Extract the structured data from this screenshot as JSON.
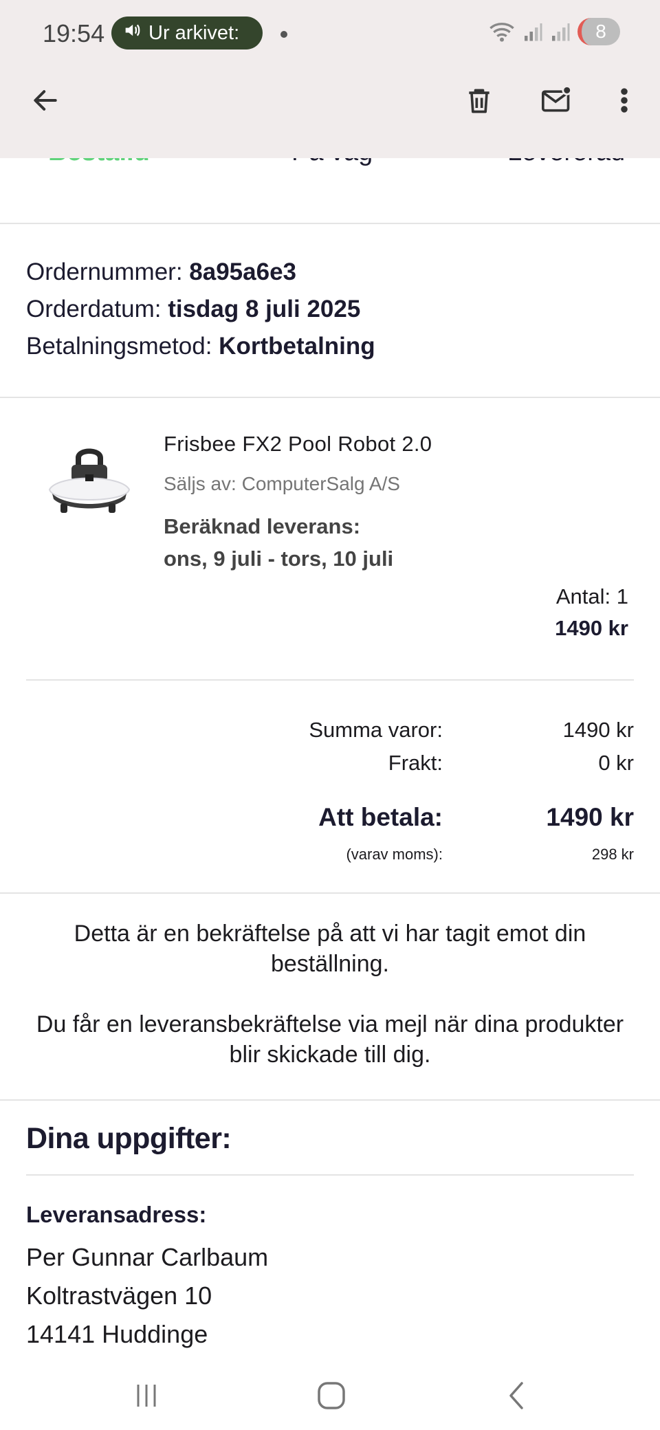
{
  "status_bar": {
    "time": "19:54",
    "pill_label": "Ur arkivet:",
    "notification_count": "8",
    "icons": [
      "speaker-icon",
      "wifi-icon",
      "signal-icon",
      "signal-icon"
    ]
  },
  "app_bar": {
    "icons": [
      "back-arrow-icon",
      "delete-icon",
      "mark-unread-icon",
      "more-vert-icon"
    ]
  },
  "tracker": {
    "steps": [
      "Beställd",
      "På väg",
      "Levererad"
    ],
    "active_color": "#5fd37a"
  },
  "order": {
    "number_label": "Ordernummer: ",
    "number_value": "8a95a6e3",
    "date_label": "Orderdatum: ",
    "date_value": "tisdag 8 juli 2025",
    "payment_label": "Betalningsmetod: ",
    "payment_value": "Kortbetalning"
  },
  "product": {
    "title": "Frisbee FX2 Pool Robot 2.0",
    "seller": "Säljs av: ComputerSalg A/S",
    "delivery_label": "Beräknad leverans:",
    "delivery_range": "ons, 9 juli - tors, 10 juli",
    "quantity": "Antal: 1",
    "price": "1490 kr"
  },
  "summary": {
    "goods_label": "Summa varor:",
    "goods_value": "1490 kr",
    "shipping_label": "Frakt:",
    "shipping_value": "0 kr",
    "total_label": "Att betala:",
    "total_value": "1490 kr",
    "vat_label": "(varav moms):",
    "vat_value": "298 kr"
  },
  "confirmation": {
    "line1": "Detta är en bekräftelse på att vi har tagit emot din",
    "line2": "beställning.",
    "line3": "Du får en leveransbekräftelse via mejl när dina produkter",
    "line4": "blir skickade till dig."
  },
  "details": {
    "title": "Dina uppgifter:",
    "address_title": "Leveransadress:",
    "name": "Per Gunnar Carlbaum",
    "street": "Koltrastvägen 10",
    "city": "14141 Huddinge"
  },
  "nav_bar": {
    "icons": [
      "recent-apps-icon",
      "home-icon",
      "back-icon"
    ]
  }
}
